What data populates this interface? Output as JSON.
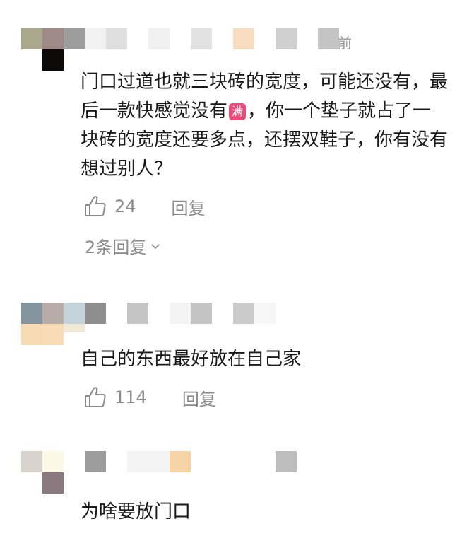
{
  "comments": [
    {
      "timestamp_fragment": "前",
      "text_parts": [
        "门口过道也就三块砖的宽度，可能还没有，最后一款快感觉没有",
        "，你一个垫子就占了一块砖的宽度还要多点，还摆双鞋子，你有没有想过别人？"
      ],
      "inline_icon": {
        "name": "full-badge-icon",
        "glyph": "满",
        "color": "#e84a7a"
      },
      "likes": "24",
      "reply_label": "回复",
      "more_replies_label": "2条回复"
    },
    {
      "text": "自己的东西最好放在自己家",
      "likes": "114",
      "reply_label": "回复"
    },
    {
      "text": "为啥要放门口"
    }
  ],
  "colors": {
    "text": "#1a1a1a",
    "muted": "#8a8a8a",
    "badge": "#e84a7a"
  }
}
